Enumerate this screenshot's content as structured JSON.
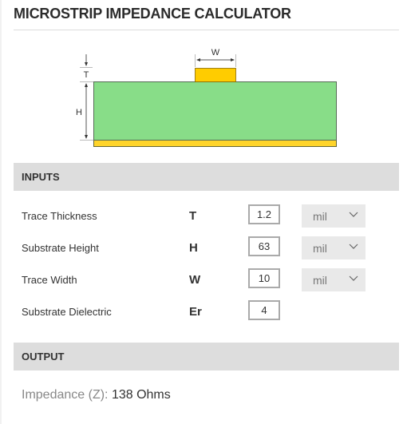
{
  "title": "MICROSTRIP IMPEDANCE CALCULATOR",
  "diagram": {
    "labels": {
      "w": "W",
      "t": "T",
      "h": "H"
    },
    "colors": {
      "substrate": "#88dd88",
      "trace": "#ffcc00",
      "ground": "#ffd42a",
      "outline": "#666633"
    }
  },
  "inputs_section": {
    "title": "INPUTS"
  },
  "inputs": [
    {
      "label": "Trace Thickness",
      "symbol": "T",
      "value": "1.2",
      "unit": "mil"
    },
    {
      "label": "Substrate Height",
      "symbol": "H",
      "value": "63",
      "unit": "mil"
    },
    {
      "label": "Trace Width",
      "symbol": "W",
      "value": "10",
      "unit": "mil"
    },
    {
      "label": "Substrate Dielectric",
      "symbol": "Er",
      "value": "4"
    }
  ],
  "output_section": {
    "title": "OUTPUT"
  },
  "output": {
    "label": "Impedance (Z):",
    "value": "138 Ohms"
  }
}
